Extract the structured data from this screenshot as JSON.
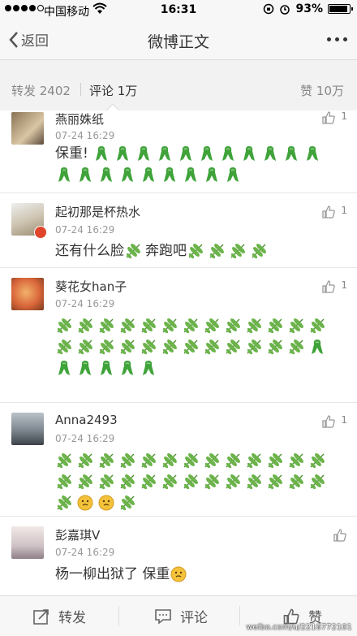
{
  "status_bar": {
    "carrier": "中国移动",
    "time": "16:31",
    "battery": "93%"
  },
  "nav": {
    "back_label": "返回",
    "title": "微博正文"
  },
  "tabs": {
    "repost": "转发 2402",
    "comment": "评论 1万",
    "like": "赞 10万"
  },
  "comments": [
    {
      "name": "燕丽姝纸",
      "time": "07-24 16:29",
      "likes": "1",
      "text": "保重!",
      "emoji": [
        "ribbon",
        "ribbon",
        "ribbon",
        "ribbon",
        "ribbon",
        "ribbon",
        "ribbon",
        "ribbon",
        "ribbon",
        "ribbon",
        "ribbon",
        "ribbon",
        "ribbon",
        "ribbon",
        "ribbon",
        "ribbon",
        "ribbon",
        "ribbon",
        "ribbon",
        "ribbon"
      ]
    },
    {
      "name": "起初那是杯热水",
      "time": "07-24 16:29",
      "likes": "1",
      "text_parts": [
        "还有什么脸",
        "奔跑吧"
      ]
    },
    {
      "name": "葵花女han子",
      "time": "07-24 16:29",
      "likes": "1"
    },
    {
      "name": "Anna2493",
      "time": "07-24 16:29",
      "likes": "1"
    },
    {
      "name": "彭嘉琪V",
      "time": "07-24 16:29",
      "likes": "",
      "text": "杨一柳出狱了 保重"
    }
  ],
  "toolbar": {
    "repost": "转发",
    "comment": "评论",
    "like": "赞",
    "watermark": "weibo.com/u/2216772101"
  },
  "colors": {
    "ribbon": "#3fa33a",
    "leaf": "#6bb34a",
    "smiley": "#f3c23a"
  }
}
